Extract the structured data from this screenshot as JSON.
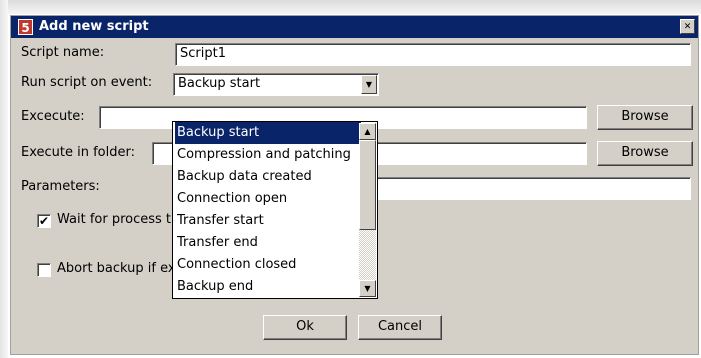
{
  "window": {
    "title": "Add new script",
    "icon_glyph": "5",
    "close_glyph": "✕"
  },
  "form": {
    "script_name_label": "Script name:",
    "script_name_value": "Script1",
    "run_on_event_label": "Run script on event:",
    "run_on_event_value": "Backup start",
    "execute_label": "Excecute:",
    "execute_value": "",
    "execute_browse": "Browse",
    "folder_label": "Execute in folder:",
    "folder_value": "",
    "folder_browse": "Browse",
    "parameters_label": "Parameters:",
    "parameters_value": "",
    "wait_label": "Wait for process t",
    "wait_checked": true,
    "abort_label": "Abort backup if ex",
    "abort_checked": false
  },
  "dropdown": {
    "selected": "Backup start",
    "items": [
      "Backup start",
      "Compression and patching",
      "Backup data created",
      "Connection open",
      "Transfer start",
      "Transfer end",
      "Connection closed",
      "Backup end"
    ]
  },
  "buttons": {
    "ok": "Ok",
    "cancel": "Cancel"
  },
  "icons": {
    "check": "✔",
    "arrow_down": "▼",
    "arrow_up": "▲"
  }
}
